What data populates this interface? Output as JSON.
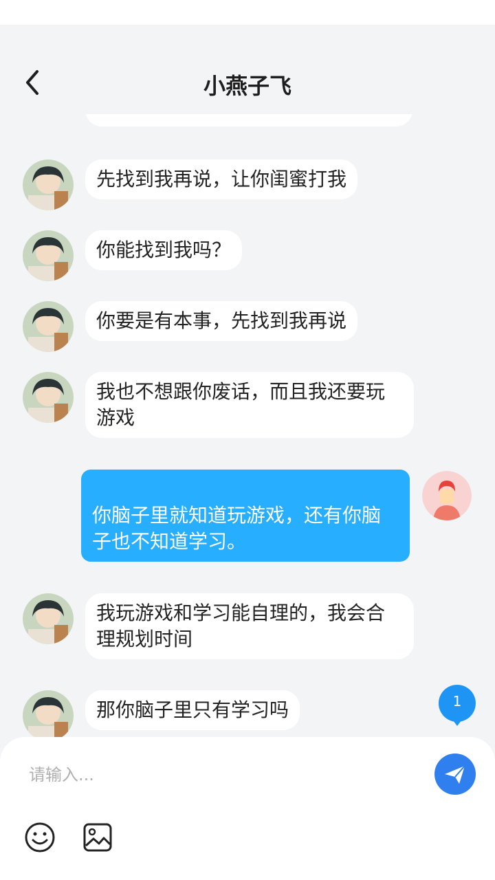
{
  "header": {
    "title": "小燕子飞",
    "back_icon": "chevron-left-icon"
  },
  "messages": [
    {
      "side": "left",
      "text": "先找到我再说，让你闺蜜打我"
    },
    {
      "side": "left",
      "text": "你能找到我吗？"
    },
    {
      "side": "left",
      "text": "你要是有本事，先找到我再说"
    },
    {
      "side": "left",
      "text": "我也不想跟你废话，而且我还要玩游戏"
    },
    {
      "side": "right",
      "text": "你脑子里就知道玩游戏，还有你脑子也不知道学习。"
    },
    {
      "side": "left",
      "text": "我玩游戏和学习能自理的，我会合理规划时间"
    },
    {
      "side": "left",
      "text": "那你脑子里只有学习吗"
    }
  ],
  "badge": {
    "count": "1"
  },
  "composer": {
    "placeholder": "请输入...",
    "send_icon": "paper-plane-icon",
    "emoji_icon": "smiley-icon",
    "image_icon": "image-icon"
  },
  "colors": {
    "mine_bubble": "#27aeff",
    "send_button": "#2f7fee",
    "badge": "#1e95f5",
    "background": "#f3f4f6"
  }
}
